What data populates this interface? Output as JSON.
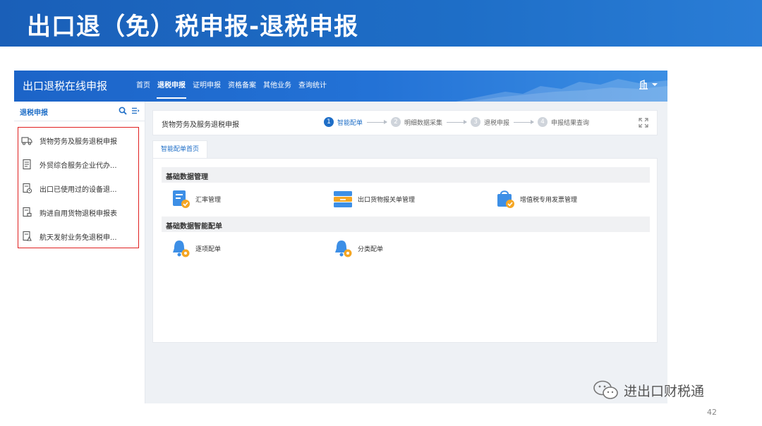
{
  "slide": {
    "title": "出口退（免）税申报-退税申报",
    "watermark": "进出口财税通",
    "page_number": "42"
  },
  "app": {
    "title": "出口退税在线申报",
    "nav": [
      "首页",
      "退税申报",
      "证明申报",
      "资格备案",
      "其他业务",
      "查询统计"
    ],
    "active_nav": "退税申报"
  },
  "sidebar": {
    "title": "退税申报",
    "items": [
      {
        "label": "货物劳务及服务退税申报",
        "icon": "truck-icon"
      },
      {
        "label": "外贸综合服务企业代办...",
        "icon": "document-icon"
      },
      {
        "label": "出口已使用过的设备退...",
        "icon": "device-document-icon"
      },
      {
        "label": "购进自用货物退税申报表",
        "icon": "cart-document-icon"
      },
      {
        "label": "航天发射业务免退税申...",
        "icon": "rocket-document-icon"
      }
    ]
  },
  "main": {
    "panel_title": "货物劳务及服务退税申报",
    "steps": [
      {
        "num": "1",
        "label": "智能配单"
      },
      {
        "num": "2",
        "label": "明细数据采集"
      },
      {
        "num": "3",
        "label": "退税申报"
      },
      {
        "num": "4",
        "label": "申报结果查询"
      }
    ],
    "active_tab": "智能配单首页",
    "sections": [
      {
        "title": "基础数据管理",
        "items": [
          {
            "label": "汇率管理",
            "icon": "exchange-rate-icon"
          },
          {
            "label": "出口货物报关单管理",
            "icon": "customs-declaration-icon"
          },
          {
            "label": "增值税专用发票管理",
            "icon": "vat-invoice-icon"
          }
        ]
      },
      {
        "title": "基础数据智能配单",
        "items": [
          {
            "label": "逐项配单",
            "icon": "itemized-matching-icon"
          },
          {
            "label": "分类配单",
            "icon": "category-matching-icon"
          }
        ]
      }
    ]
  },
  "colors": {
    "banner": "#1e6ec7",
    "accent": "#1e6ec7",
    "highlight_box": "#e02020",
    "icon_blue": "#3d8fe6",
    "icon_orange": "#f5a623"
  }
}
